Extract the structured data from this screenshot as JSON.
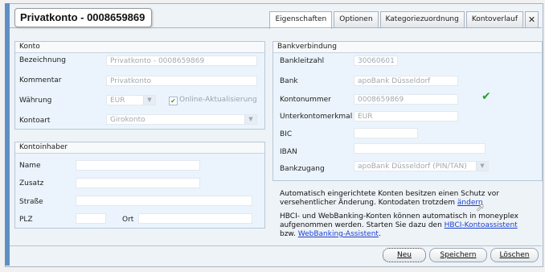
{
  "title": "Privatkonto - 0008659869",
  "tabs": [
    {
      "label": "Eigenschaften",
      "active": true
    },
    {
      "label": "Optionen",
      "active": false
    },
    {
      "label": "Kategoriezuordnung",
      "active": false
    },
    {
      "label": "Kontoverlauf",
      "active": false
    }
  ],
  "close_symbol": "✕",
  "konto": {
    "header": "Konto",
    "bezeichnung_label": "Bezeichnung",
    "bezeichnung_value": "Privatkonto - 0008659869",
    "kommentar_label": "Kommentar",
    "kommentar_value": "Privatkonto",
    "waehrung_label": "Währung",
    "waehrung_value": "EUR",
    "online_label": "Online-Aktualisierung",
    "kontoart_label": "Kontoart",
    "kontoart_value": "Girokonto"
  },
  "inhaber": {
    "header": "Kontoinhaber",
    "name_label": "Name",
    "zusatz_label": "Zusatz",
    "strasse_label": "Straße",
    "plz_label": "PLZ",
    "ort_label": "Ort"
  },
  "bank": {
    "header": "Bankverbindung",
    "blz_label": "Bankleitzahl",
    "blz_value": "30060601",
    "bank_label": "Bank",
    "bank_value": "apoBank Düsseldorf",
    "kontonummer_label": "Kontonummer",
    "kontonummer_value": "0008659869",
    "unterkonto_label": "Unterkontomerkmal",
    "unterkonto_value": "EUR",
    "bic_label": "BIC",
    "iban_label": "IBAN",
    "zugang_label": "Bankzugang",
    "zugang_value": "apoBank Düsseldorf (PIN/TAN)"
  },
  "info": {
    "p1_text": "Automatisch eingerichtete Konten besitzen einen Schutz vor versehentlicher Änderung. Kontodaten trotzdem",
    "p1_link": "ändern",
    "p2_text": "HBCI- und WebBanking-Konten können automatisch in moneyplex aufgenommen werden. Starten Sie dazu den",
    "p2_link1": "HBCI-Kontoassistent",
    "p2_mid": "bzw.",
    "p2_link2": "WebBanking-Assistent"
  },
  "buttons": {
    "neu": "Neu",
    "speichern": "Speichern",
    "loeschen": "Löschen"
  },
  "colors": {
    "accent": "#5f8fc4",
    "group_bg": "#ebf4fc",
    "link": "#1a3ecf",
    "ok": "#2aa22a"
  }
}
